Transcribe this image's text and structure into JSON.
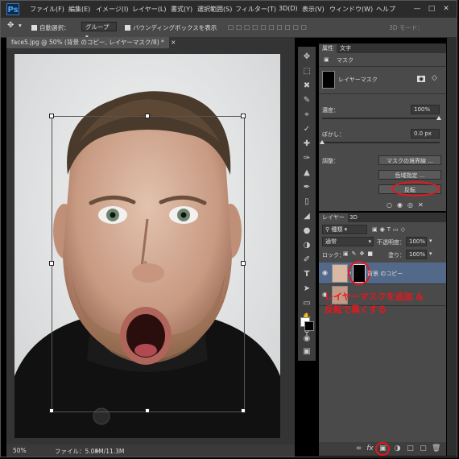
{
  "app": {
    "logo": "Ps"
  },
  "menubar": {
    "items": [
      "ファイル(F)",
      "編集(E)",
      "イメージ(I)",
      "レイヤー(L)",
      "書式(Y)",
      "選択範囲(S)",
      "フィルター(T)",
      "3D(D)",
      "表示(V)",
      "ウィンドウ(W)",
      "ヘルプ"
    ]
  },
  "options": {
    "auto_select": "自動選択：",
    "group": "グループ",
    "bounding_box": "バウンディングボックスを表示",
    "mode3d": "3D モード："
  },
  "document": {
    "tab_title": "face5.jpg @ 50% (背景 のコピー, レイヤーマスク/8) *",
    "zoom": "50%",
    "file_info": "ファイル：5.04M/11.3M"
  },
  "properties": {
    "tabs": [
      "属性",
      "文字"
    ],
    "section": "マスク",
    "layer_mask": "レイヤーマスク",
    "density_label": "濃度：",
    "density_value": "100%",
    "feather_label": "ぼかし：",
    "feather_value": "0.0 px",
    "adjust_label": "調整：",
    "btn_mask_edge": "マスクの境界線 ...",
    "btn_color_range": "色域指定 ...",
    "btn_invert": "反転"
  },
  "layers": {
    "tabs": [
      "レイヤー",
      "3D"
    ],
    "kind": "種類",
    "blend_mode": "通常",
    "opacity_label": "不透明度：",
    "opacity_value": "100%",
    "lock_label": "ロック：",
    "fill_label": "塗り：",
    "fill_value": "100%",
    "layer1_name": "背景 のコピー"
  },
  "annotation": {
    "line1": "レイヤーマスクを追加 &",
    "line2": "反転で黒くする",
    "color": "#e8161c"
  },
  "colors": {
    "ui_dark": "#2b2b2b",
    "panel": "#4a4a4a",
    "selected_layer": "#53698a"
  }
}
